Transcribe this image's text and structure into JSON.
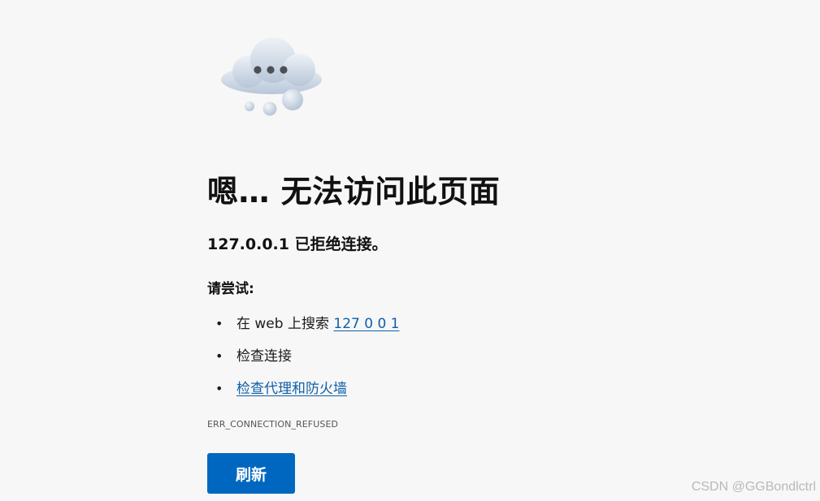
{
  "error_page": {
    "icon": "cloud-thinking-icon",
    "title": "嗯… 无法访问此页面",
    "subtitle": "127.0.0.1 已拒绝连接。",
    "try_heading": "请尝试:",
    "suggestions": [
      {
        "prefix": "在 web 上搜索 ",
        "link": "127 0 0 1"
      },
      {
        "text": "检查连接"
      },
      {
        "link": "检查代理和防火墙"
      }
    ],
    "error_code": "ERR_CONNECTION_REFUSED",
    "refresh_label": "刷新"
  },
  "watermark": "CSDN @GGBondlctrl",
  "colors": {
    "background": "#f7f7f7",
    "accent": "#0067c0",
    "link": "#0f5fa8"
  }
}
